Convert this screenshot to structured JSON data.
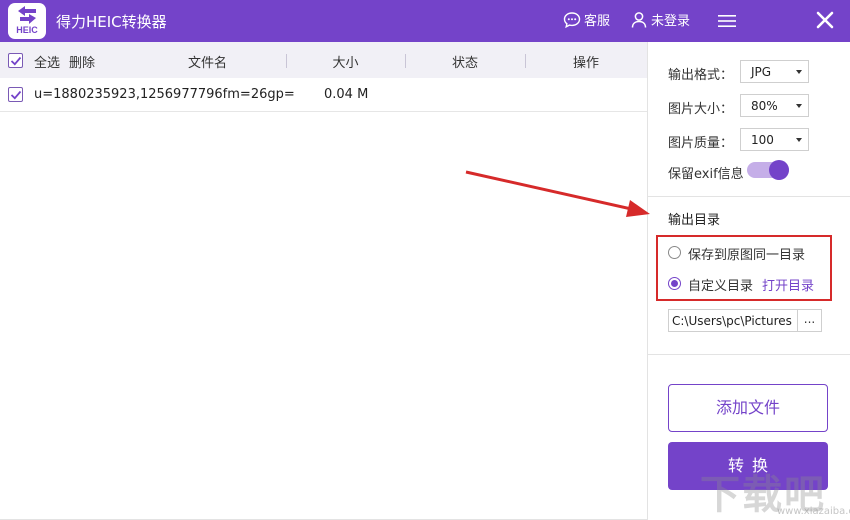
{
  "titlebar": {
    "app_title": "得力HEIC转换器",
    "logo_text": "HEIC",
    "service_label": "客服",
    "login_label": "未登录"
  },
  "filelist": {
    "select_all_label": "全选",
    "delete_label": "删除",
    "columns": {
      "name": "文件名",
      "size": "大小",
      "status": "状态",
      "action": "操作"
    },
    "rows": [
      {
        "name": "u=1880235923,1256977796fm=26gp=",
        "size": "0.04 M",
        "status": "",
        "action": "",
        "checked": true
      }
    ]
  },
  "panel": {
    "format_label": "输出格式：",
    "format_value": "JPG",
    "size_label": "图片大小：",
    "size_value": "80%",
    "quality_label": "图片质量：",
    "quality_value": "100",
    "exif_label": "保留exif信息",
    "exif_on": true,
    "output_dir_title": "输出目录",
    "radio_same_dir": "保存到原图同一目录",
    "radio_custom_dir": "自定义目录",
    "open_dir_link": "打开目录",
    "path_value": "C:\\Users\\pc\\Pictures",
    "browse_label": "...",
    "add_file_button": "添加文件",
    "convert_button": "转换"
  },
  "colors": {
    "accent": "#7443c9",
    "annotation": "#d62a2a"
  },
  "watermark": {
    "text": "下载吧",
    "sub": "www.xiazaiba.com"
  }
}
